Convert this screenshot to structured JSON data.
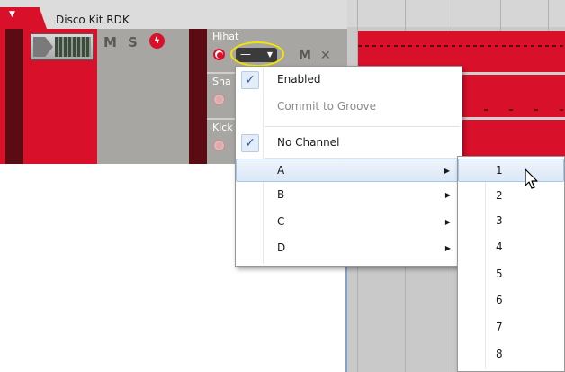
{
  "device": {
    "name": "Disco Kit RDK",
    "mute_label": "M",
    "solo_label": "S",
    "power_icon": "power-icon"
  },
  "lanes": [
    {
      "name": "Hihat",
      "channel": "—",
      "mute_label": "M",
      "close_label": "✕"
    },
    {
      "name": "Sna"
    },
    {
      "name": "Kick"
    }
  ],
  "menu": {
    "enabled": "Enabled",
    "commit": "Commit to Groove",
    "no_channel": "No Channel",
    "check_mark": "✓",
    "channels": [
      "A",
      "B",
      "C",
      "D"
    ]
  },
  "submenu": {
    "items": [
      "1",
      "2",
      "3",
      "4",
      "5",
      "6",
      "7",
      "8"
    ]
  },
  "colors": {
    "track_red": "#d8102a",
    "dark_red": "#5a0c12",
    "highlight": "#f2e300"
  }
}
